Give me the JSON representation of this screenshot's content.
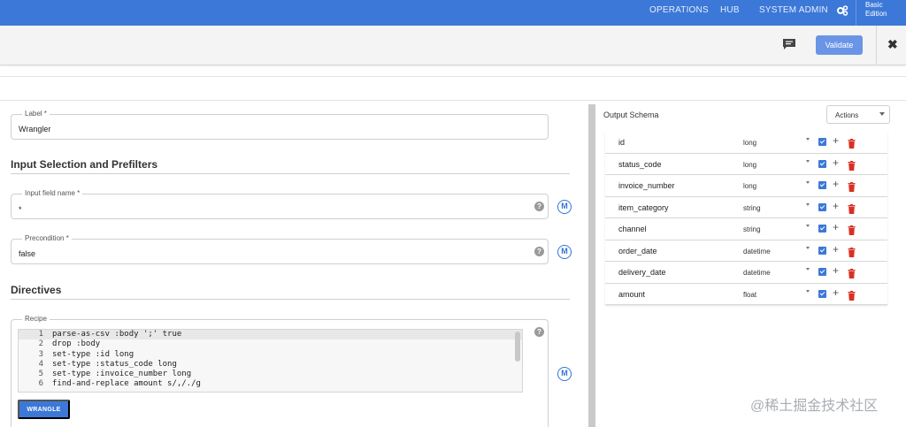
{
  "topnav": {
    "items": [
      "OPERATIONS",
      "HUB",
      "SYSTEM ADMIN"
    ],
    "edition_line1": "Basic",
    "edition_line2": "Edition",
    "gear_icon": "gear-icon"
  },
  "toolbar": {
    "comment_icon": "comment-icon",
    "validate_label": "Validate",
    "close_symbol": "✖"
  },
  "form": {
    "label": {
      "title": "Label *",
      "value": "Wrangler"
    },
    "input_section_title": "Input Selection and Prefilters",
    "input_field": {
      "title": "Input field name *",
      "value": "*"
    },
    "precondition": {
      "title": "Precondition *",
      "value": "false"
    },
    "directives_title": "Directives",
    "recipe": {
      "title": "Recipe",
      "lines": [
        {
          "n": "1",
          "code": "parse-as-csv :body ';' true"
        },
        {
          "n": "2",
          "code": "drop :body"
        },
        {
          "n": "3",
          "code": "set-type :id long"
        },
        {
          "n": "4",
          "code": "set-type :status_code long"
        },
        {
          "n": "5",
          "code": "set-type :invoice_number long"
        },
        {
          "n": "6",
          "code": "find-and-replace amount s/,/./g"
        }
      ]
    },
    "wrangle_label": "WRANGLE",
    "help_symbol": "?",
    "macro_symbol": "M"
  },
  "schema": {
    "title": "Output Schema",
    "actions_label": "Actions",
    "plus_symbol": "+",
    "fields": [
      {
        "name": "id",
        "type": "long"
      },
      {
        "name": "status_code",
        "type": "long"
      },
      {
        "name": "invoice_number",
        "type": "long"
      },
      {
        "name": "item_category",
        "type": "string"
      },
      {
        "name": "channel",
        "type": "string"
      },
      {
        "name": "order_date",
        "type": "datetime"
      },
      {
        "name": "delivery_date",
        "type": "datetime"
      },
      {
        "name": "amount",
        "type": "float"
      }
    ]
  },
  "watermark": "@稀土掘金技术社区",
  "colors": {
    "brand_blue": "#3c78d8",
    "validate_blue": "#6a95e6",
    "delete_red": "#d93025"
  }
}
